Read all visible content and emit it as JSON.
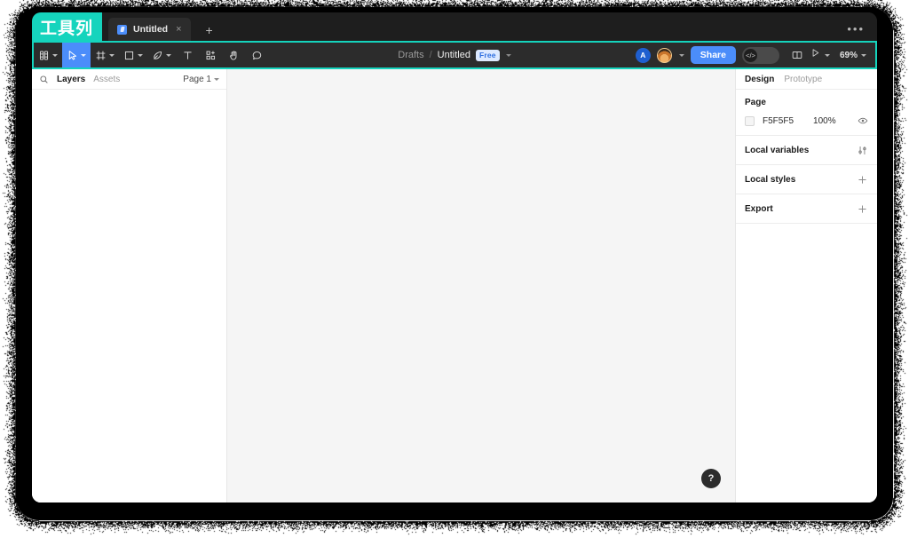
{
  "annotation": {
    "label": "工具列",
    "accent_color": "#15d4bd"
  },
  "tabbar": {
    "tabs": [
      {
        "title": "Untitled",
        "icon": "figma-file-icon",
        "close_label": "×"
      }
    ],
    "new_tab_label": "+",
    "more_label": "•••"
  },
  "toolbar": {
    "tools": [
      {
        "name": "main-menu",
        "icon": "figma-logo-icon",
        "has_caret": true,
        "active": false
      },
      {
        "name": "move",
        "icon": "cursor-icon",
        "has_caret": true,
        "active": true
      },
      {
        "name": "frame",
        "icon": "frame-icon",
        "has_caret": true,
        "active": false
      },
      {
        "name": "shape",
        "icon": "rectangle-icon",
        "has_caret": true,
        "active": false
      },
      {
        "name": "pen",
        "icon": "pen-icon",
        "has_caret": true,
        "active": false
      },
      {
        "name": "text",
        "icon": "text-icon",
        "has_caret": false,
        "active": false
      },
      {
        "name": "actions",
        "icon": "components-icon",
        "has_caret": false,
        "active": false
      },
      {
        "name": "hand",
        "icon": "hand-icon",
        "has_caret": false,
        "active": false
      },
      {
        "name": "comment",
        "icon": "comment-icon",
        "has_caret": false,
        "active": false
      }
    ],
    "breadcrumb": {
      "parent": "Drafts",
      "separator": "/",
      "current": "Untitled",
      "badge": "Free"
    },
    "avatars": [
      {
        "type": "initial",
        "label": "A"
      },
      {
        "type": "photo",
        "label": ""
      }
    ],
    "share_label": "Share",
    "devmode_label": "</>",
    "zoom_label": "69%"
  },
  "left_panel": {
    "search_icon": "search-icon",
    "tabs": [
      {
        "label": "Layers",
        "active": true
      },
      {
        "label": "Assets",
        "active": false
      }
    ],
    "page_selector": "Page 1"
  },
  "right_panel": {
    "tabs": [
      {
        "label": "Design",
        "active": true
      },
      {
        "label": "Prototype",
        "active": false
      }
    ],
    "page_section": {
      "title": "Page",
      "color_hex": "F5F5F5",
      "color_value": "#F5F5F5",
      "opacity": "100%",
      "visibility_icon": "eye-icon"
    },
    "rows": [
      {
        "label": "Local variables",
        "action_icon": "sliders-icon"
      },
      {
        "label": "Local styles",
        "action_icon": "plus-icon"
      },
      {
        "label": "Export",
        "action_icon": "plus-icon"
      }
    ]
  },
  "canvas": {
    "background": "#F5F5F5",
    "help_label": "?"
  }
}
